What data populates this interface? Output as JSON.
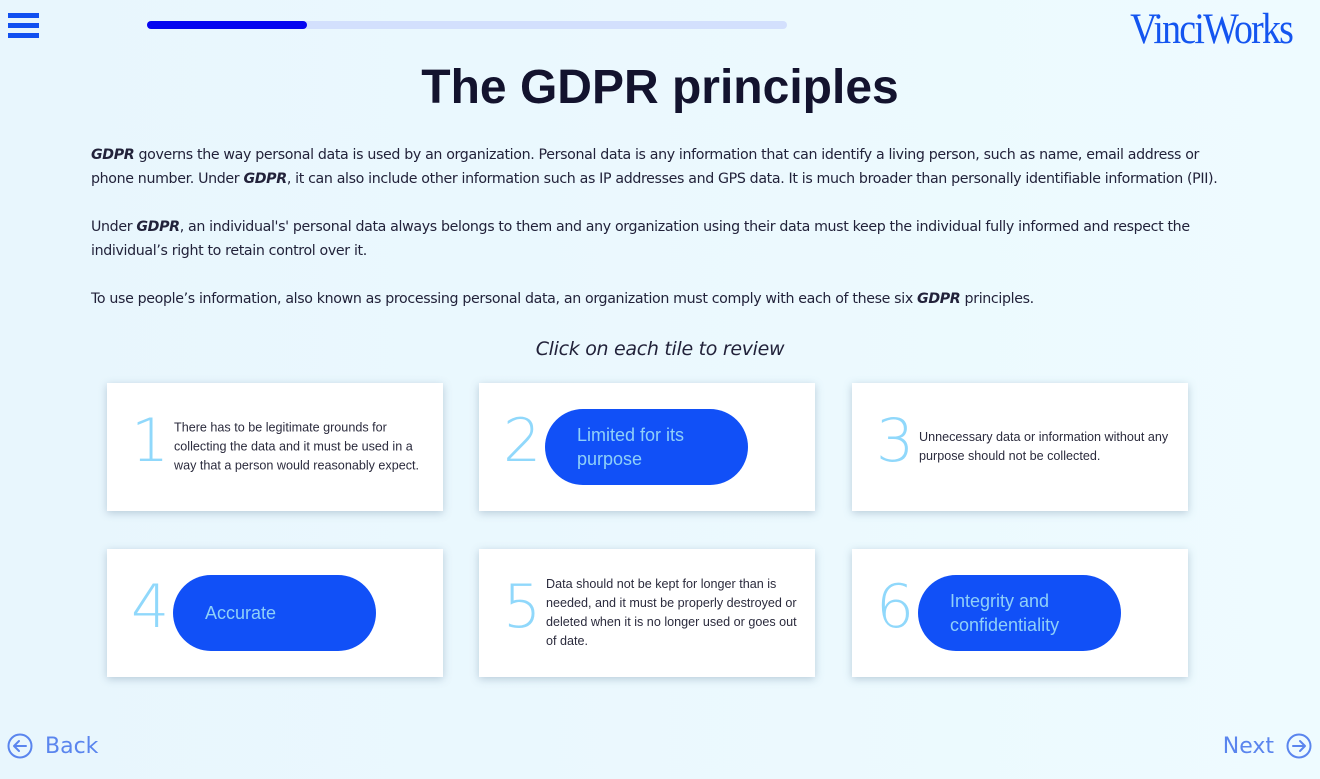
{
  "header": {
    "menu_icon": "hamburger-menu-icon",
    "progress_fraction": 0.25,
    "progress_colors": {
      "fill": "#0505f0",
      "track": "#d3e0fd"
    },
    "logo_text": "VinciWorks"
  },
  "page": {
    "title": "The GDPR principles",
    "intro": [
      [
        {
          "text": "GDPR",
          "bold": true
        },
        {
          "text": " governs the way personal data is used by an organization. Personal data is any information that can identify a living person, such as name, email address or phone number. Under "
        },
        {
          "text": "GDPR",
          "bold": true
        },
        {
          "text": ", it can also include other information such as IP addresses and GPS data. It is much broader than personally identifiable information (PII)."
        }
      ],
      [
        {
          "text": "Under "
        },
        {
          "text": "GDPR",
          "bold": true
        },
        {
          "text": ", an individual's' personal data always belongs to them and any organization using their data must keep the individual fully informed and respect the individual’s right to retain control over it."
        }
      ],
      [
        {
          "text": "To use people’s information, also known as processing personal data, an organization must comply with each of these six "
        },
        {
          "text": "GDPR",
          "bold": true
        },
        {
          "text": " principles."
        }
      ]
    ],
    "instruction": "Click on each tile to review"
  },
  "tiles": [
    {
      "number": "1",
      "state": "revealed",
      "text": "There has to be legitimate grounds for collecting the data and it must be used in a way that a person would reasonably expect."
    },
    {
      "number": "2",
      "state": "label",
      "text": "Limited for its purpose"
    },
    {
      "number": "3",
      "state": "revealed",
      "text": "Unnecessary data or information without any purpose should not be collected."
    },
    {
      "number": "4",
      "state": "label",
      "text": "Accurate"
    },
    {
      "number": "5",
      "state": "revealed",
      "text": "Data should not be kept for longer than is needed, and it must be properly destroyed or deleted when it is no longer used or goes out of date."
    },
    {
      "number": "6",
      "state": "label",
      "text": "Integrity and confidentiality"
    }
  ],
  "colors": {
    "accent": "#1150f7",
    "number": "#90d8fb",
    "pill_text": "#8fd0f8",
    "nav": "#5a85ee"
  },
  "nav": {
    "back_label": "Back",
    "back_icon": "arrow-left-circle-icon",
    "next_label": "Next",
    "next_icon": "arrow-right-circle-icon"
  }
}
